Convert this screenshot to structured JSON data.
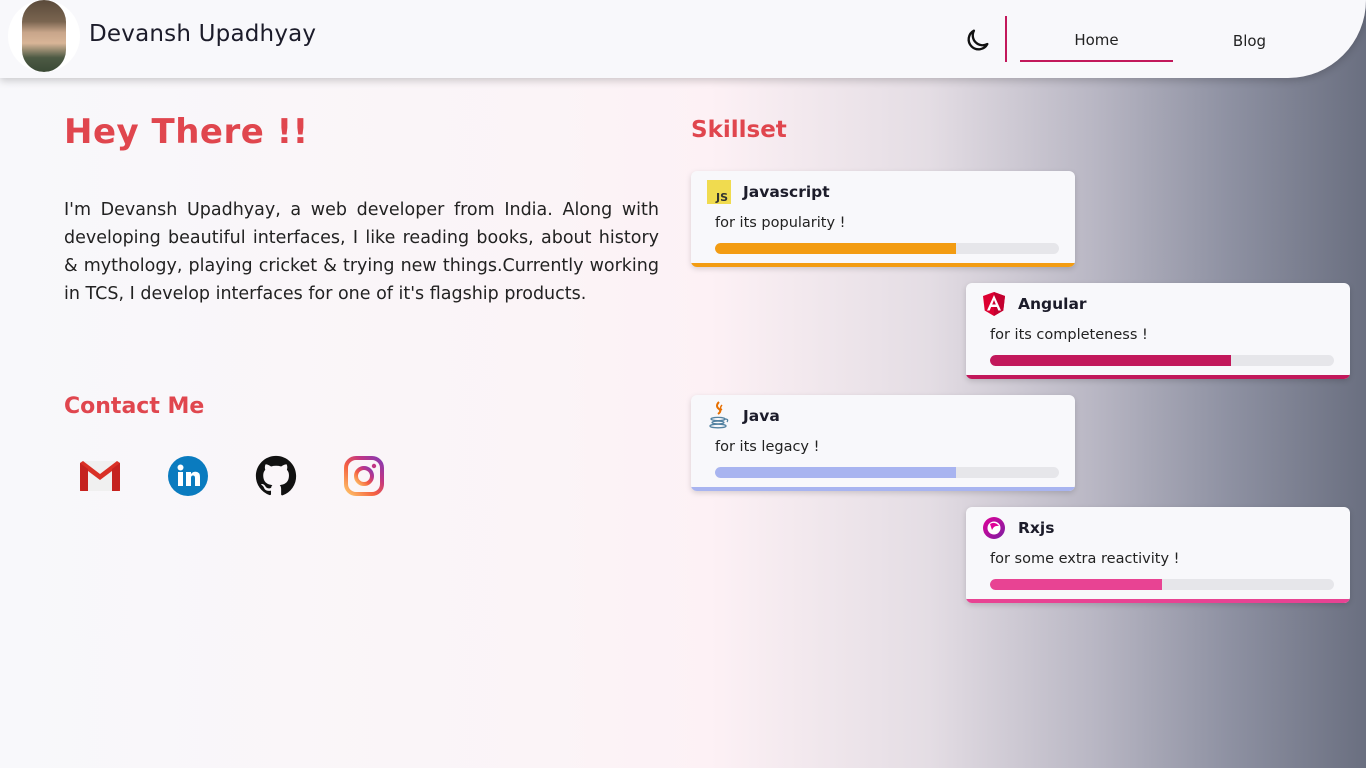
{
  "header": {
    "name": "Devansh Upadhyay",
    "nav": [
      {
        "label": "Home",
        "active": true
      },
      {
        "label": "Blog",
        "active": false
      }
    ],
    "accent_color": "#c2185b",
    "theme_icon": "moon-icon"
  },
  "hero": {
    "title": "Hey There !!",
    "bio": "I'm Devansh Upadhyay, a web developer from India. Along with developing beautiful interfaces, I like reading books, about history & mythology, playing cricket & trying new things.Currently working in TCS, I develop interfaces for one of it's flagship products."
  },
  "contact": {
    "title": "Contact Me",
    "links": [
      {
        "icon": "gmail-icon"
      },
      {
        "icon": "linkedin-icon"
      },
      {
        "icon": "github-icon"
      },
      {
        "icon": "instagram-icon"
      }
    ]
  },
  "skills": {
    "title": "Skillset",
    "items": [
      {
        "name": "Javascript",
        "reason": "for its popularity !",
        "level": 0.7,
        "color": "#f39c12",
        "icon": "javascript-icon"
      },
      {
        "name": "Angular",
        "reason": "for its completeness !",
        "level": 0.7,
        "color": "#c2185b",
        "icon": "angular-icon"
      },
      {
        "name": "Java",
        "reason": "for its legacy !",
        "level": 0.7,
        "color": "#a8b4f0",
        "icon": "java-icon"
      },
      {
        "name": "Rxjs",
        "reason": "for some extra reactivity !",
        "level": 0.5,
        "color": "#e84393",
        "icon": "rxjs-icon"
      }
    ]
  }
}
